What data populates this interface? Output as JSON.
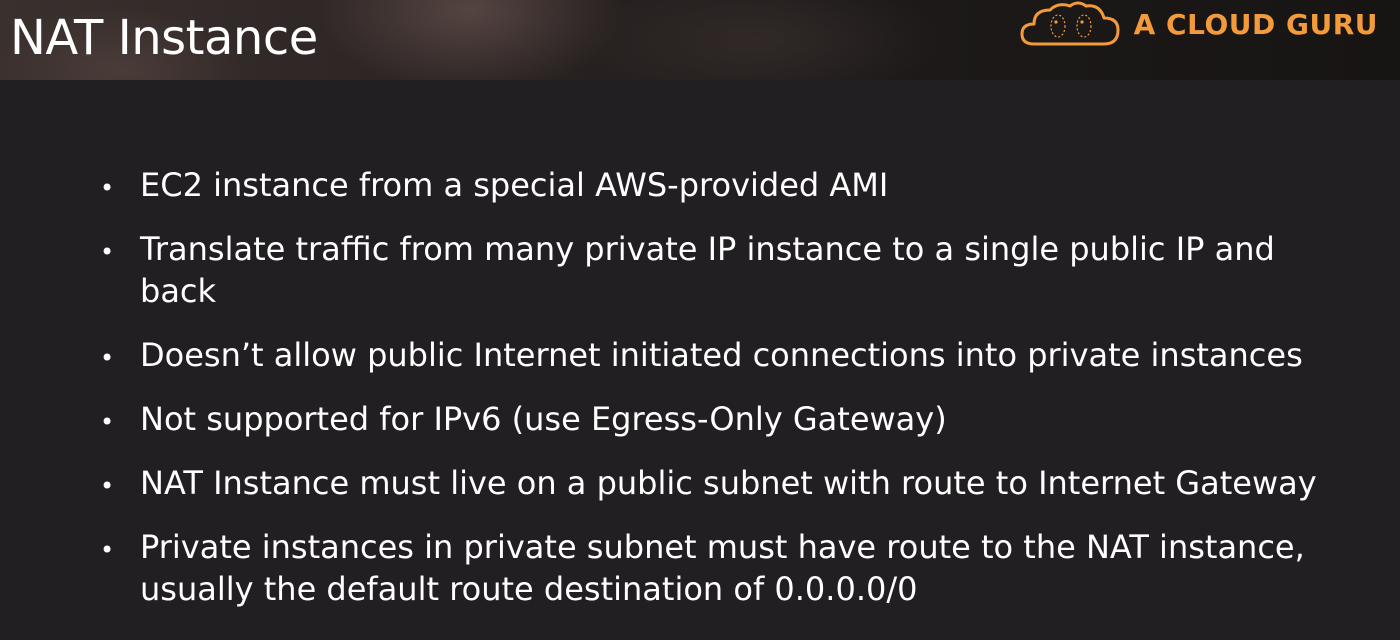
{
  "slide": {
    "title": "NAT Instance",
    "logo_text": "A CLOUD GURU",
    "logo_icon": "cloud-icon",
    "accent_color": "#f39a3a",
    "bullets": [
      "EC2 instance from a special AWS-provided AMI",
      "Translate traffic from many private IP instance to a single public IP and back",
      "Doesn’t allow public Internet initiated connections into private instances",
      "Not supported for IPv6 (use Egress-Only Gateway)",
      "NAT Instance must live on a public subnet with route to Internet Gateway",
      "Private instances in private subnet must have route to the NAT instance, usually the default route destination of 0.0.0.0/0"
    ]
  }
}
